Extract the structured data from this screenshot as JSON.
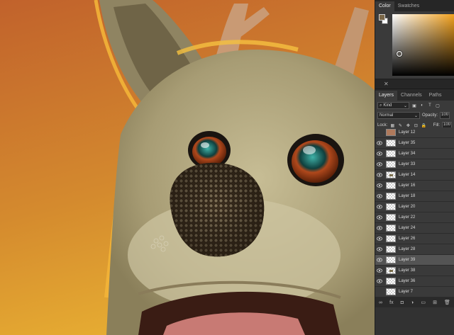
{
  "color_panel": {
    "tabs": [
      {
        "label": "Color"
      },
      {
        "label": "Swatches"
      }
    ],
    "foreground_color": "#7a6748",
    "background_color": "#ffffff",
    "hue_color": "#f2a11d"
  },
  "layers_panel": {
    "tabs": [
      {
        "label": "Layers"
      },
      {
        "label": "Channels"
      },
      {
        "label": "Paths"
      }
    ],
    "filter": {
      "label": "Kind"
    },
    "blend_mode": "Normal",
    "opacity_label": "Opacity:",
    "opacity_value": "100",
    "lock_label": "Lock:",
    "fill_label": "Fill:",
    "fill_value": "100",
    "layers": [
      {
        "name": "Layer 12",
        "visible": false,
        "selected": false,
        "thumb": "photo"
      },
      {
        "name": "Layer 35",
        "visible": true,
        "selected": false,
        "thumb": "transparent"
      },
      {
        "name": "Layer 34",
        "visible": true,
        "selected": false,
        "thumb": "transparent"
      },
      {
        "name": "Layer 33",
        "visible": true,
        "selected": false,
        "thumb": "transparent"
      },
      {
        "name": "Layer 14",
        "visible": true,
        "selected": false,
        "thumb": "mark"
      },
      {
        "name": "Layer 16",
        "visible": true,
        "selected": false,
        "thumb": "transparent"
      },
      {
        "name": "Layer 18",
        "visible": true,
        "selected": false,
        "thumb": "transparent"
      },
      {
        "name": "Layer 20",
        "visible": true,
        "selected": false,
        "thumb": "transparent"
      },
      {
        "name": "Layer 22",
        "visible": true,
        "selected": false,
        "thumb": "transparent"
      },
      {
        "name": "Layer 24",
        "visible": true,
        "selected": false,
        "thumb": "transparent"
      },
      {
        "name": "Layer 26",
        "visible": true,
        "selected": false,
        "thumb": "transparent"
      },
      {
        "name": "Layer 28",
        "visible": true,
        "selected": false,
        "thumb": "transparent"
      },
      {
        "name": "Layer 39",
        "visible": true,
        "selected": true,
        "thumb": "transparent"
      },
      {
        "name": "Layer 38",
        "visible": true,
        "selected": false,
        "thumb": "mark"
      },
      {
        "name": "Layer 36",
        "visible": true,
        "selected": false,
        "thumb": "transparent"
      },
      {
        "name": "Layer 7",
        "visible": false,
        "selected": false,
        "thumb": "transparent"
      }
    ],
    "bottom_icons": [
      "link-icon",
      "fx-icon",
      "mask-icon",
      "adjustment-icon",
      "folder-icon",
      "new-layer-icon",
      "trash-icon"
    ],
    "bottom_labels": {
      "fx": "fx"
    }
  },
  "canvas": {
    "description_colors": {
      "background_top": "#c1622c",
      "background_bottom": "#e3a530",
      "fur": "#b8ad85",
      "rim_light": "#f5b73a",
      "nose": "#3e3020"
    }
  }
}
